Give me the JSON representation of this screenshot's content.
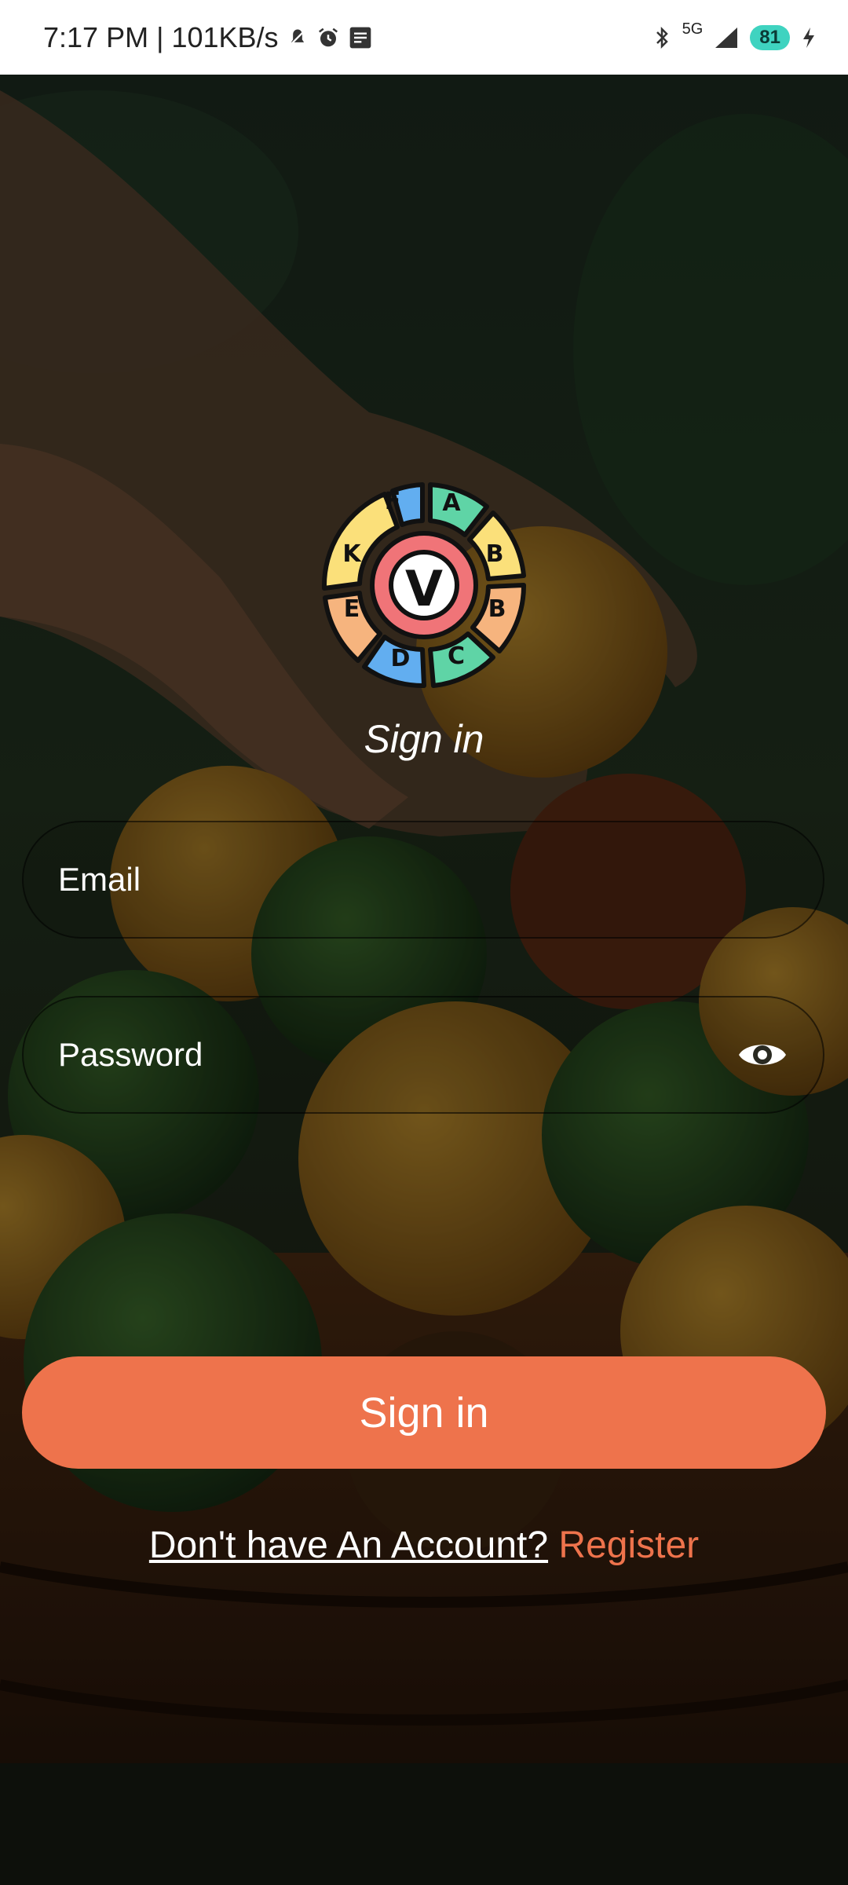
{
  "status_bar": {
    "time": "7:17 PM",
    "speed": "101KB/s",
    "network": "5G",
    "battery": "81",
    "icons": [
      "bell-off-icon",
      "alarm-icon",
      "notes-icon",
      "bluetooth-icon",
      "signal-icon",
      "charging-icon"
    ]
  },
  "logo": {
    "center_letter": "V",
    "ring_letters": [
      "F",
      "A",
      "B",
      "B",
      "C",
      "D",
      "E",
      "K"
    ],
    "colors": {
      "center": "#f07478",
      "blue": "#62aef0",
      "green": "#5fd4a6",
      "yellow": "#fbe07a",
      "orange": "#f6b47e"
    }
  },
  "form": {
    "title": "Sign in",
    "email_placeholder": "Email",
    "password_placeholder": "Password",
    "submit_label": "Sign in",
    "register_question": "Don't have An Account?",
    "register_link": "Register"
  },
  "colors": {
    "accent": "#ee734c",
    "text": "#ffffff"
  }
}
